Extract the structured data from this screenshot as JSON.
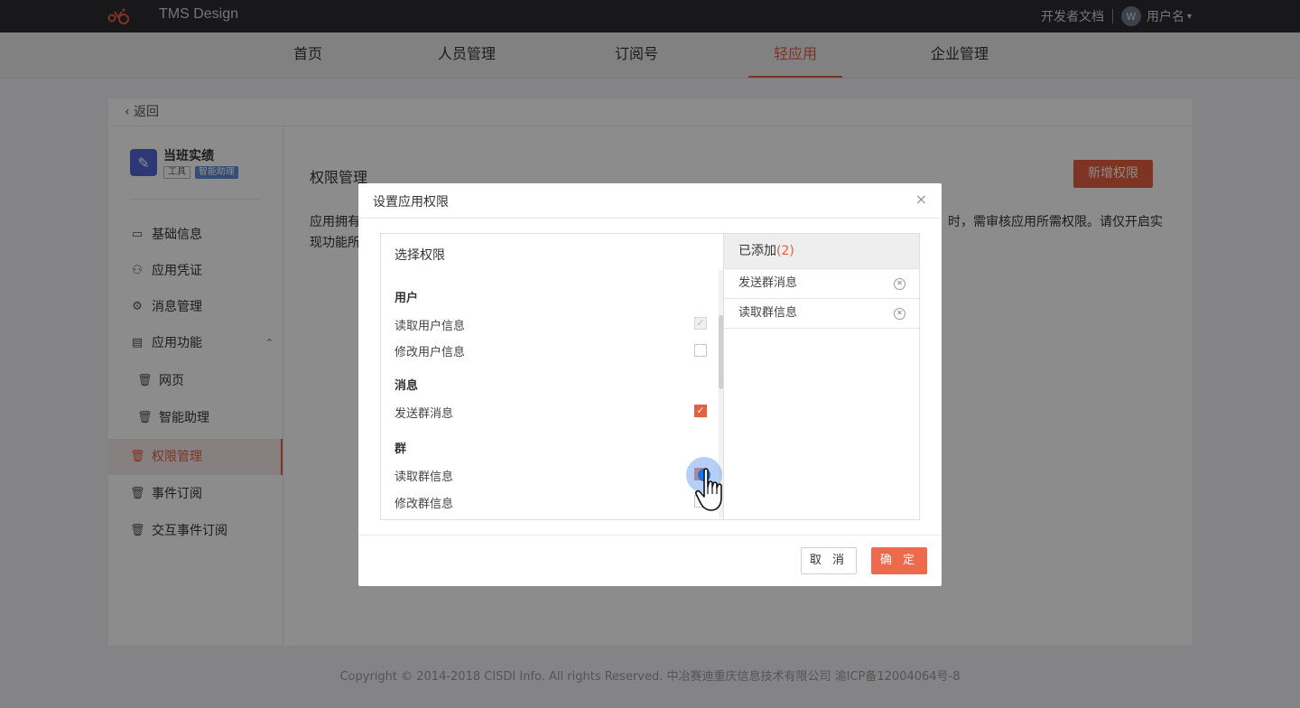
{
  "topbar": {
    "brand": "TMS Design",
    "dev_docs": "开发者文档",
    "username": "用户名",
    "avatar_initial": "W"
  },
  "nav": {
    "items": [
      "首页",
      "人员管理",
      "订阅号",
      "轻应用",
      "企业管理"
    ],
    "active_index": 3
  },
  "back": {
    "label": "返回"
  },
  "app": {
    "name": "当班实绩",
    "tag_tool": "工具",
    "tag_ai": "智能助理"
  },
  "sidebar": {
    "items": [
      {
        "label": "基础信息",
        "icon": "monitor-icon"
      },
      {
        "label": "应用凭证",
        "icon": "user-icon"
      },
      {
        "label": "消息管理",
        "icon": "gear-icon"
      },
      {
        "label": "应用功能",
        "icon": "book-icon"
      },
      {
        "label": "网页",
        "icon": "trash-icon"
      },
      {
        "label": "智能助理",
        "icon": "trash-icon"
      },
      {
        "label": "权限管理",
        "icon": "trash-icon"
      },
      {
        "label": "事件订阅",
        "icon": "trash-icon"
      },
      {
        "label": "交互事件订阅",
        "icon": "trash-icon"
      }
    ],
    "active_label": "权限管理"
  },
  "main": {
    "title": "权限管理",
    "add_button": "新增权限",
    "desc_left_1": "应用拥有",
    "desc_right_1": "时，需审核应用所需权限。请仅开启实",
    "desc_left_2": "现功能所"
  },
  "modal": {
    "title": "设置应用权限",
    "left_header": "选择权限",
    "groups": [
      {
        "name": "用户",
        "options": [
          {
            "label": "读取用户信息",
            "state": "disabled-checked"
          },
          {
            "label": "修改用户信息",
            "state": "unchecked"
          }
        ]
      },
      {
        "name": "消息",
        "options": [
          {
            "label": "发送群消息",
            "state": "checked"
          }
        ]
      },
      {
        "name": "群",
        "options": [
          {
            "label": "读取群信息",
            "state": "checked"
          },
          {
            "label": "修改群信息",
            "state": "unchecked"
          }
        ]
      }
    ],
    "right_header": "已添加",
    "right_count": "(2)",
    "selected": [
      "发送群消息",
      "读取群信息"
    ],
    "cancel": "取 消",
    "ok": "确 定"
  },
  "footer": {
    "text": "Copyright © 2014-2018 CISDI Info. All rights Reserved. 中冶赛迪重庆信息技术有限公司 渝ICP备12004064号-8"
  },
  "colors": {
    "accent": "#e6603f",
    "topbar": "#2c2d31",
    "touch": "#1a73e8"
  }
}
